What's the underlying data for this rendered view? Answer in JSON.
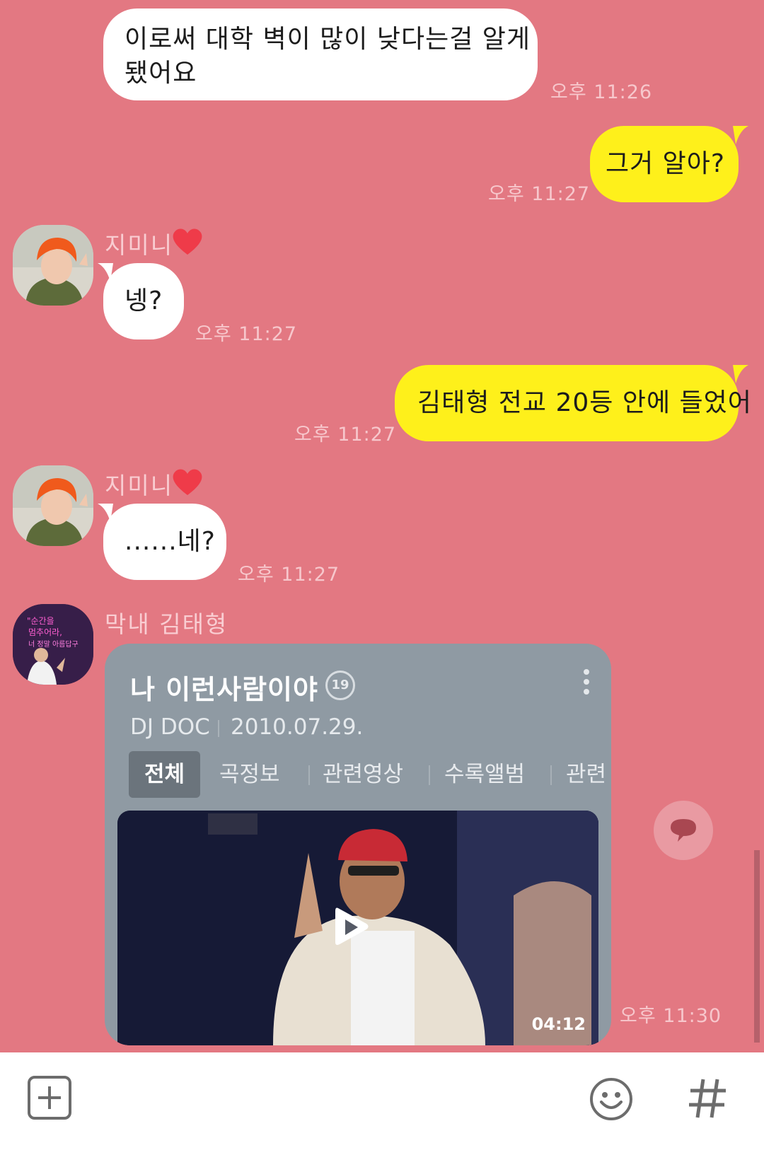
{
  "messages": [
    {
      "id": 1,
      "direction": "in",
      "lines": [
        "이로써 대학 벽이 많이 낮다는걸 알게",
        "됐어요"
      ],
      "time": "오후 11:26"
    },
    {
      "id": 2,
      "direction": "out",
      "text": "그거 알아?",
      "time": "오후 11:27"
    },
    {
      "id": 3,
      "direction": "in",
      "sender": "지미니",
      "text": "넹?",
      "time": "오후 11:27"
    },
    {
      "id": 4,
      "direction": "out",
      "text": "김태형 전교 20등 안에 들었어",
      "time": "오후 11:27"
    },
    {
      "id": 5,
      "direction": "in",
      "sender": "지미니",
      "text": "......네?",
      "time": "오후 11:27"
    },
    {
      "id": 6,
      "direction": "in",
      "sender": "막내 김태형",
      "type": "music_card",
      "time": "오후 11:30"
    }
  ],
  "music_card": {
    "title": "나 이런사람이야",
    "age_badge": "19",
    "artist": "DJ DOC",
    "date": "2010.07.29.",
    "tabs": [
      "전체",
      "곡정보",
      "관련영상",
      "수록앨범",
      "관련"
    ],
    "active_tab": "전체",
    "duration": "04:12"
  },
  "avatar_art": {
    "neon_lines": [
      "\"순간을",
      "멈추어라,",
      "너 정말 아름답구"
    ]
  },
  "colors": {
    "chat_background": "#e37882",
    "outgoing_bubble": "#fef01b",
    "incoming_bubble": "#ffffff",
    "card_background": "#8f9aa3"
  },
  "icons": {
    "bottom_left": "plus-square-icon",
    "bottom_emoji": "smiley-icon",
    "bottom_right": "hash-icon",
    "card_play": "play-icon",
    "comment": "speech-bubble-icon"
  }
}
